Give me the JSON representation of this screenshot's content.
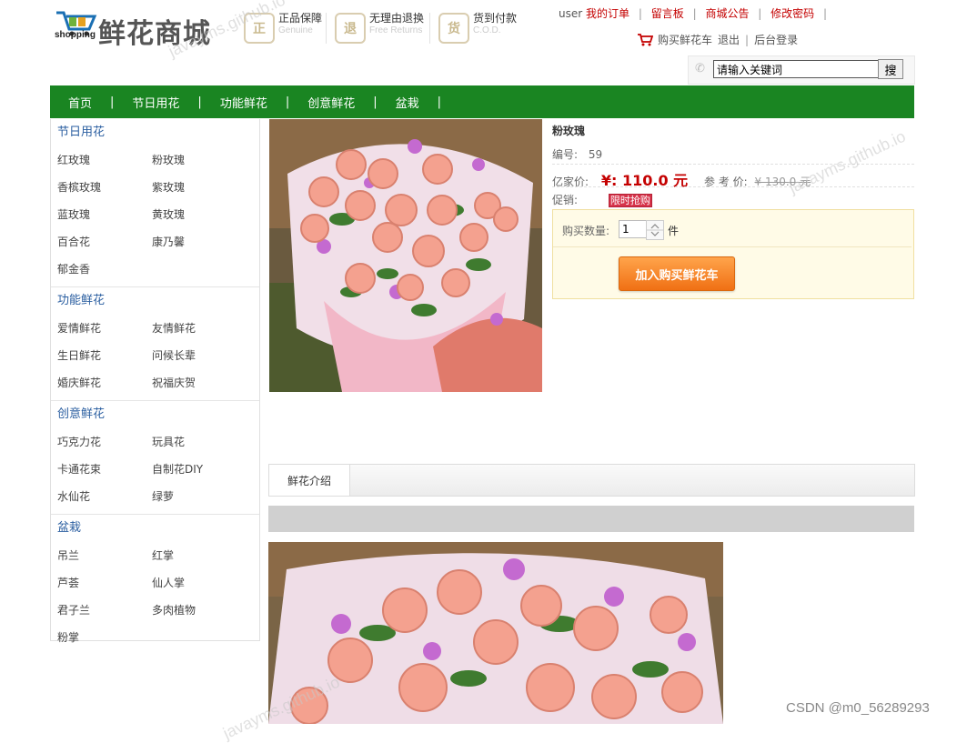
{
  "header": {
    "logo_shopping": "shopping",
    "logo_title": "鲜花商城",
    "guarantees": [
      {
        "icon": "shield-icon",
        "glyph": "正",
        "label": "正品保障",
        "sub": "Genuine"
      },
      {
        "icon": "return-icon",
        "glyph": "退",
        "label": "无理由退换",
        "sub": "Free Returns"
      },
      {
        "icon": "cod-icon",
        "glyph": "货",
        "label": "货到付款",
        "sub": "C.O.D."
      }
    ],
    "user": "user",
    "top_links": [
      "我的订单",
      "留言板",
      "商城公告",
      "修改密码"
    ],
    "cart_link": "购买鲜花车",
    "logout": "退出",
    "admin_login": "后台登录",
    "search": {
      "value": "请输入关键词",
      "button": "搜"
    }
  },
  "nav": [
    "首页",
    "节日用花",
    "功能鲜花",
    "创意鲜花",
    "盆栽"
  ],
  "sidebar": {
    "categories": [
      {
        "title": "节日用花",
        "items": [
          "红玫瑰",
          "粉玫瑰",
          "香槟玫瑰",
          "紫玫瑰",
          "蓝玫瑰",
          "黄玫瑰",
          "百合花",
          "康乃馨",
          "郁金香"
        ]
      },
      {
        "title": "功能鲜花",
        "items": [
          "爱情鲜花",
          "友情鲜花",
          "生日鲜花",
          "问候长辈",
          "婚庆鲜花",
          "祝福庆贺"
        ]
      },
      {
        "title": "创意鲜花",
        "items": [
          "巧克力花",
          "玩具花",
          "卡通花束",
          "自制花DIY",
          "水仙花",
          "绿萝"
        ]
      },
      {
        "title": "盆栽",
        "items": [
          "吊兰",
          "红掌",
          "芦荟",
          "仙人掌",
          "君子兰",
          "多肉植物",
          "粉掌"
        ]
      }
    ]
  },
  "product": {
    "name": "粉玫瑰",
    "id_label": "编号:",
    "id_value": "59",
    "price_label": "亿家价:",
    "price": "¥: 110.0 元",
    "ref_label": "参 考 价:",
    "ref_price": "¥ 130.0 元",
    "promo_label": "促销:",
    "promo_badge": "限时抢购",
    "qty_label": "购买数量:",
    "qty_value": "1",
    "qty_unit": "件",
    "add_to_cart": "加入购买鲜花车"
  },
  "tabs": {
    "active": "鲜花介绍"
  },
  "watermarks": [
    "javayms.github.io",
    "javayms.github.io",
    "javayms.github.io"
  ],
  "footer": {
    "csdn": "CSDN @m0_56289293"
  },
  "colors": {
    "nav_green": "#1a8522",
    "price_red": "#c40000",
    "cart_orange": "#f07014"
  }
}
